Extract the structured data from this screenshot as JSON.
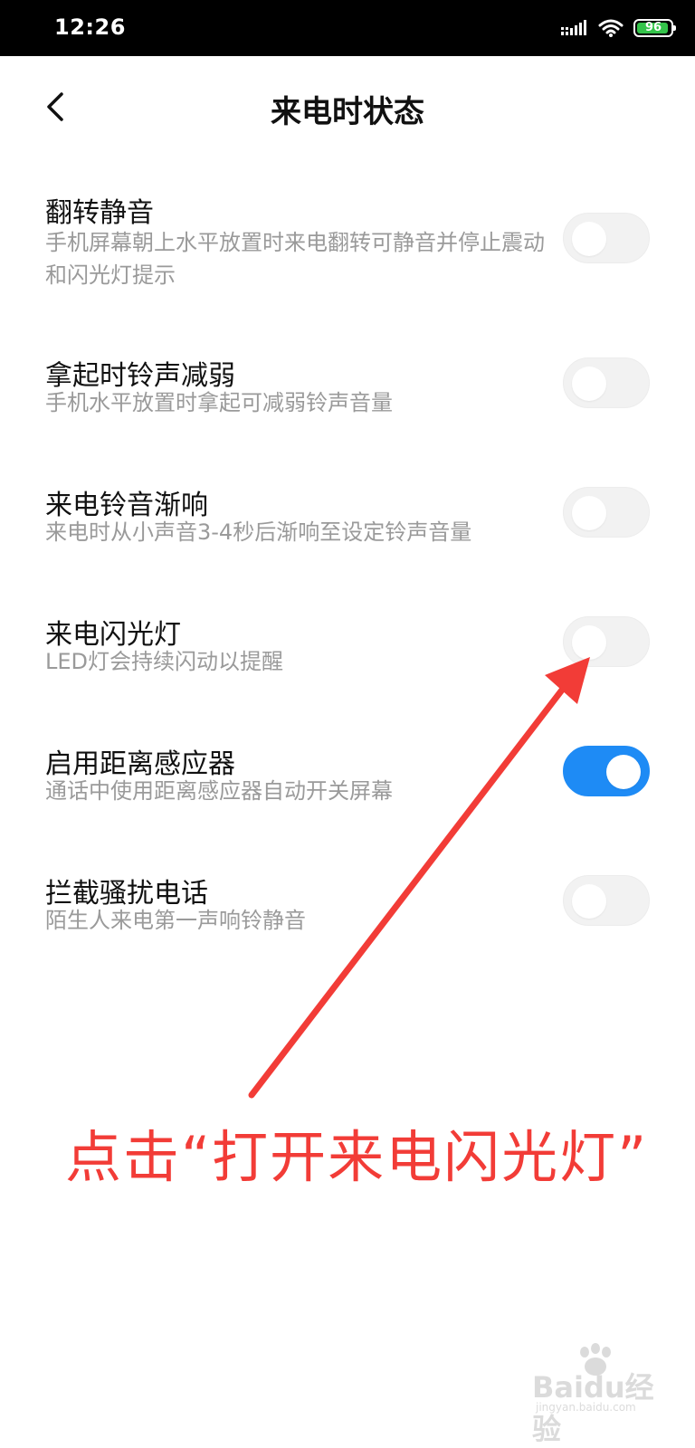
{
  "status_bar": {
    "time": "12:26",
    "battery_level": "96",
    "battery_color": "#34c34a",
    "icons": [
      "signal-icon",
      "wifi-icon",
      "battery-icon"
    ]
  },
  "header": {
    "title": "来电时状态",
    "back_icon": "chevron-left-icon"
  },
  "settings": [
    {
      "title": "翻转静音",
      "description": "手机屏幕朝上水平放置时来电翻转可静音并停止震动和闪光灯提示",
      "enabled": false
    },
    {
      "title": "拿起时铃声减弱",
      "description": "手机水平放置时拿起可减弱铃声音量",
      "enabled": false
    },
    {
      "title": "来电铃音渐响",
      "description": "来电时从小声音3-4秒后渐响至设定铃声音量",
      "enabled": false
    },
    {
      "title": "来电闪光灯",
      "description": "LED灯会持续闪动以提醒",
      "enabled": false
    },
    {
      "title": "启用距离感应器",
      "description": "通话中使用距离感应器自动开关屏幕",
      "enabled": true
    },
    {
      "title": "拦截骚扰电话",
      "description": "陌生人来电第一声响铃静音",
      "enabled": false
    }
  ],
  "annotation": {
    "text": "点击“打开来电闪光灯”",
    "color": "#f23c37"
  },
  "watermark": {
    "text": "Baidu经验",
    "sub": "jingyan.baidu.com"
  },
  "colors": {
    "toggle_on": "#1e8bf5",
    "toggle_off": "#f2f2f2",
    "description": "#9a9a9a"
  }
}
